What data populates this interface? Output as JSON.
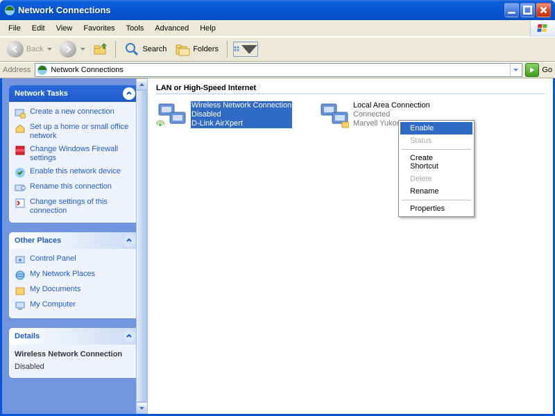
{
  "window": {
    "title": "Network Connections"
  },
  "menubar": [
    "File",
    "Edit",
    "View",
    "Favorites",
    "Tools",
    "Advanced",
    "Help"
  ],
  "toolbar": {
    "back": "Back",
    "search": "Search",
    "folders": "Folders"
  },
  "addressbar": {
    "label": "Address",
    "value": "Network Connections",
    "go": "Go"
  },
  "sidebar": {
    "panels": [
      {
        "title": "Network Tasks",
        "primary": true,
        "items": [
          {
            "label": "Create a new connection",
            "icon": "new-connection-icon"
          },
          {
            "label": "Set up a home or small office network",
            "icon": "home-network-icon"
          },
          {
            "label": "Change Windows Firewall settings",
            "icon": "firewall-icon"
          },
          {
            "label": "Enable this network device",
            "icon": "enable-device-icon"
          },
          {
            "label": "Rename this connection",
            "icon": "rename-icon"
          },
          {
            "label": "Change settings of this connection",
            "icon": "settings-icon"
          }
        ]
      },
      {
        "title": "Other Places",
        "primary": false,
        "items": [
          {
            "label": "Control Panel",
            "icon": "control-panel-icon"
          },
          {
            "label": "My Network Places",
            "icon": "network-places-icon"
          },
          {
            "label": "My Documents",
            "icon": "my-documents-icon"
          },
          {
            "label": "My Computer",
            "icon": "my-computer-icon"
          }
        ]
      },
      {
        "title": "Details",
        "primary": false,
        "details": {
          "name": "Wireless Network Connection",
          "status": "Disabled"
        }
      }
    ]
  },
  "main": {
    "group_header": "LAN or High-Speed Internet",
    "connections": [
      {
        "name": "Wireless Network Connection",
        "status": "Disabled",
        "device": "D-Link AirXpert",
        "selected": true
      },
      {
        "name": "Local Area Connection",
        "status": "Connected",
        "device": "Marvell Yukon 88E8001/8003/...",
        "selected": false
      }
    ]
  },
  "contextmenu": {
    "items": [
      {
        "label": "Enable",
        "hl": true
      },
      {
        "label": "Status",
        "disabled": true
      },
      {
        "sep": true
      },
      {
        "label": "Create Shortcut"
      },
      {
        "label": "Delete",
        "disabled": true
      },
      {
        "label": "Rename"
      },
      {
        "sep": true
      },
      {
        "label": "Properties"
      }
    ]
  }
}
